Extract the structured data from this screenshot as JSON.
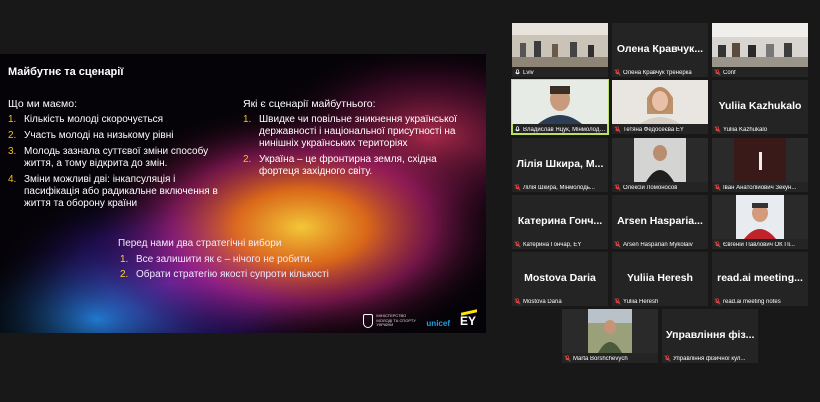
{
  "slide": {
    "title": "Майбутнє та сценарії",
    "left_heading": "Що ми маємо:",
    "left_items": [
      {
        "n": "1.",
        "text": "Кількість молоді скорочується"
      },
      {
        "n": "2.",
        "text": "Участь молоді на низькому рівні"
      },
      {
        "n": "3.",
        "text": "Молодь зазнала суттєвої зміни способу життя, а тому відкрита до змін."
      },
      {
        "n": "4.",
        "text": "Зміни можливі двi: інкапсуляція і пасифікація або радикальне включення в життя та оборону країни"
      }
    ],
    "right_heading": "Які є сценарії майбутнього:",
    "right_items": [
      {
        "n": "1.",
        "text": "Швидке чи повільне зникнення української державності і національної присутності на нинішніх українських територіях"
      },
      {
        "n": "2.",
        "text": "Україна – це фронтирна земля, східна фортеця західного світу."
      }
    ],
    "strategy_heading": "Перед нами два стратегічні вибори",
    "strategy_items": [
      {
        "n": "1.",
        "text": "Все залишити як є – нічого не робити."
      },
      {
        "n": "2.",
        "text": "Обрати стратегію якості супроти кількості"
      }
    ],
    "logos": {
      "ministry": "МІНІСТЕРСТВО МОЛОДІ ТА СПОРТУ УКРАЇНИ",
      "unicef": "unicef",
      "ey": "EY"
    }
  },
  "participants": [
    {
      "name": "Lviv",
      "center_name": "",
      "video": true,
      "muted": false
    },
    {
      "name": "Олена Кравчук тренерка",
      "center_name": "Олена Кравчук...",
      "video": false,
      "muted": true
    },
    {
      "name": "Conf",
      "center_name": "",
      "video": true,
      "muted": true
    },
    {
      "name": "Владислав Яцук, Мінмолодь...",
      "center_name": "",
      "video": true,
      "muted": false,
      "speaking": true
    },
    {
      "name": "Тетяна Федосеєва EY",
      "center_name": "",
      "video": true,
      "muted": true
    },
    {
      "name": "Yuliia Kazhukalo",
      "center_name": "Yuliia Kazhukalo",
      "video": false,
      "muted": true
    },
    {
      "name": "Лілія Шкира, Мінмолодь...",
      "center_name": "Лілія Шкира, М...",
      "video": false,
      "muted": true
    },
    {
      "name": "Олексій Ломоносов",
      "center_name": "",
      "video": true,
      "muted": true
    },
    {
      "name": "Іван Анатолійович Зекун...",
      "center_name": "",
      "video": true,
      "muted": true
    },
    {
      "name": "Катерина Гончар, EY",
      "center_name": "Катерина Гонч...",
      "video": false,
      "muted": true
    },
    {
      "name": "Arsen Hasparian Mykolaiv",
      "center_name": "Arsen Hasparia...",
      "video": false,
      "muted": true
    },
    {
      "name": "Євгеній Павлович ОК Пі...",
      "center_name": "",
      "video": true,
      "muted": true
    },
    {
      "name": "Mostova Daria",
      "center_name": "Mostova Daria",
      "video": false,
      "muted": true
    },
    {
      "name": "Yuliia Heresh",
      "center_name": "Yuliia Heresh",
      "video": false,
      "muted": true
    },
    {
      "name": "read.ai meeting notes",
      "center_name": "read.ai meeting...",
      "video": false,
      "muted": true
    },
    {
      "name": "Marta Borshchevych",
      "center_name": "",
      "video": true,
      "muted": true
    },
    {
      "name": "Управління фізичної кул...",
      "center_name": "Управління фіз...",
      "video": false,
      "muted": true
    }
  ],
  "colors": {
    "background": "#181818",
    "tile": "#242424",
    "active_speaker": "#b9e25e",
    "bullet_number": "#f2c21b",
    "muted_mic": "#e04646"
  }
}
